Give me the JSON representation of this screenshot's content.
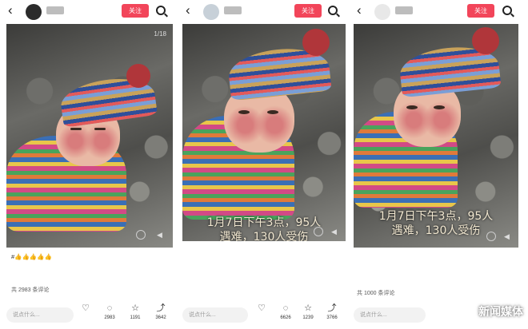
{
  "follow_label": "关注",
  "panels": [
    {
      "photo_counter": "1/18",
      "caption": "#👍👍👍👍👍",
      "meta": "",
      "comments_count": "共 2983 条评论",
      "comment_placeholder": "说点什么...",
      "actions": [
        {
          "icon": "heart-icon",
          "value": ""
        },
        {
          "icon": "comment-icon",
          "value": "2983"
        },
        {
          "icon": "star-icon",
          "value": "1191"
        },
        {
          "icon": "share-icon",
          "value": "3642"
        }
      ]
    },
    {
      "overlay_line1": "1月7日下午3点，95人",
      "overlay_line2": "遇难，130人受伤",
      "caption_line1": "",
      "caption_line2": "",
      "caption_line3": "",
      "meta": "",
      "comment_placeholder": "说点什么...",
      "actions": [
        {
          "icon": "heart-icon",
          "value": ""
        },
        {
          "icon": "comment-icon",
          "value": "6626"
        },
        {
          "icon": "star-icon",
          "value": "1239"
        },
        {
          "icon": "share-icon",
          "value": "3766"
        }
      ]
    },
    {
      "overlay_line1": "1月7日下午3点，95人",
      "overlay_line2": "遇难，130人受伤",
      "caption": "",
      "meta": "",
      "comments_count": "共 1000 条评论",
      "comment_placeholder": "说点什么...",
      "watermark": "新闻媒体"
    }
  ],
  "colors": {
    "accent": "#f2455a",
    "overlay_text": "#f1e7d0"
  }
}
